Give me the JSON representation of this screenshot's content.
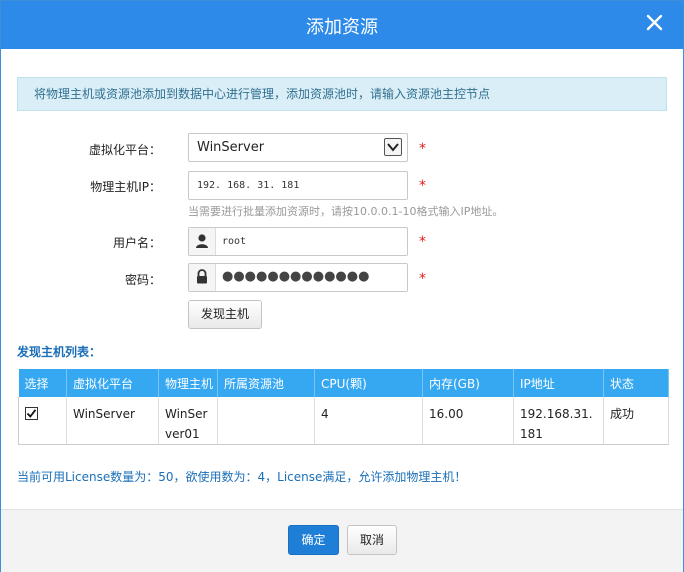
{
  "dialog": {
    "title": "添加资源",
    "close_icon": "close-icon"
  },
  "info_text": "将物理主机或资源池添加到数据中心进行管理，添加资源池时，请输入资源池主控节点",
  "form": {
    "platform": {
      "label": "虚拟化平台：",
      "value": "WinServer",
      "required": "*"
    },
    "ip": {
      "label": "物理主机IP：",
      "value": "192. 168. 31. 181",
      "required": "*",
      "hint": "当需要进行批量添加资源时，请按10.0.0.1-10格式输入IP地址。"
    },
    "username": {
      "label": "用户名：",
      "value": "root",
      "required": "*",
      "icon": "user-icon"
    },
    "password": {
      "label": "密码：",
      "value": "●●●●●●●●●●●●●",
      "required": "*",
      "icon": "lock-icon"
    },
    "discover_button": "发现主机"
  },
  "host_list": {
    "title": "发现主机列表：",
    "columns": [
      "选择",
      "虚拟化平台",
      "物理主机",
      "所属资源池",
      "CPU(颗)",
      "内存(GB)",
      "IP地址",
      "状态"
    ],
    "rows": [
      {
        "selected": true,
        "platform": "WinServer",
        "host": "WinServer01",
        "pool": "",
        "cpu": "4",
        "memory": "16.00",
        "ip": "192.168.31.181",
        "status": "成功"
      }
    ]
  },
  "license_text": "当前可用License数量为：50，欲使用数为：4，License满足，允许添加物理主机！",
  "footer": {
    "ok": "确定",
    "cancel": "取消"
  },
  "colors": {
    "titlebar": "#2d8ae8",
    "table_header": "#36a8f2",
    "primary_button": "#1f7fd6",
    "required": "#e02020"
  }
}
